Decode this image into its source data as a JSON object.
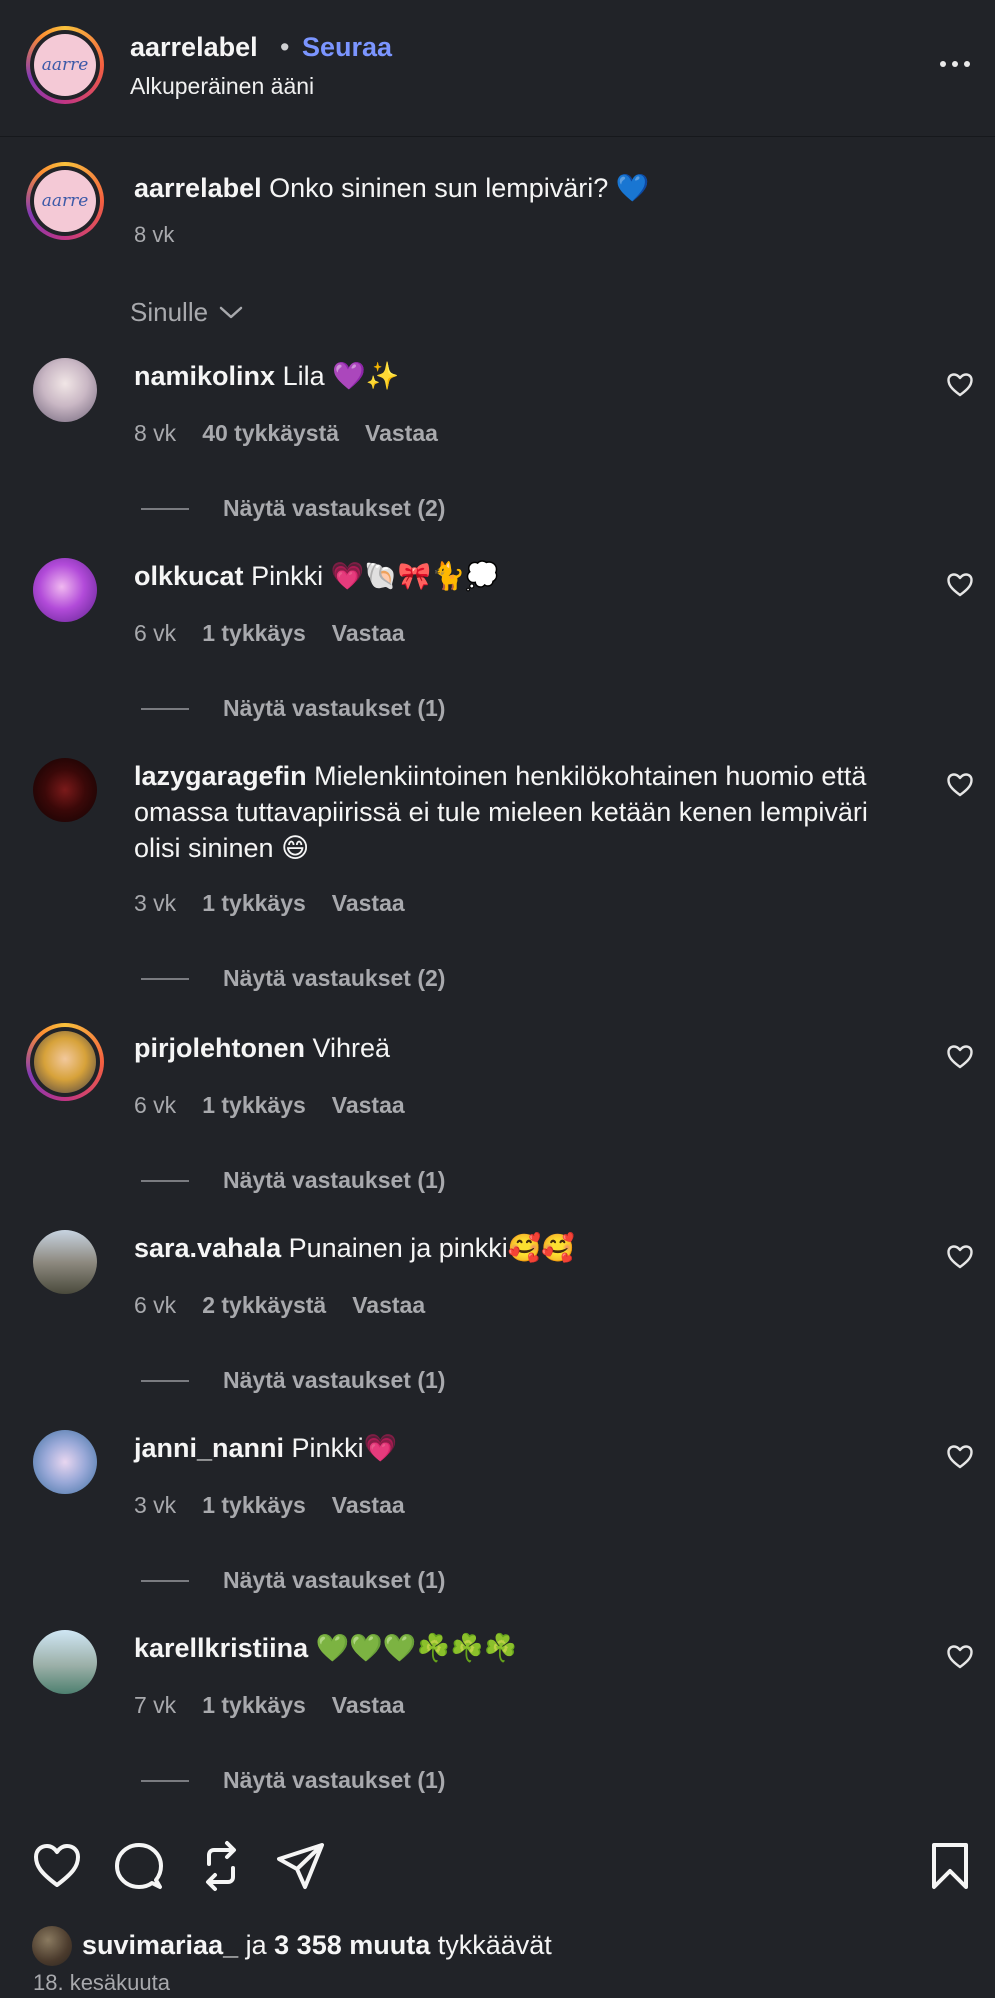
{
  "header": {
    "username": "aarrelabel",
    "separator": "•",
    "follow_label": "Seuraa",
    "subtitle": "Alkuperäinen ääni",
    "avatar_text": "aarre",
    "more_icon": "more-horizontal-icon"
  },
  "caption": {
    "username": "aarrelabel",
    "text": "Onko sininen sun lempiväri? 💙",
    "time": "8 vk"
  },
  "sort": {
    "label": "Sinulle"
  },
  "comments": [
    {
      "username": "namikolinx",
      "text": "Lila 💜✨",
      "time": "8 vk",
      "likes": "40 tykkäystä",
      "reply": "Vastaa",
      "view_replies": "Näytä vastaukset (2)"
    },
    {
      "username": "olkkucat",
      "text": "Pinkki 💗🐚🎀🐈💭",
      "time": "6 vk",
      "likes": "1 tykkäys",
      "reply": "Vastaa",
      "view_replies": "Näytä vastaukset (1)"
    },
    {
      "username": "lazygaragefin",
      "text": "Mielenkiintoinen henkilökohtainen huomio että omassa tuttavapiirissä ei tule mieleen ketään kenen lempiväri olisi sininen 😄",
      "time": "3 vk",
      "likes": "1 tykkäys",
      "reply": "Vastaa",
      "view_replies": "Näytä vastaukset (2)"
    },
    {
      "username": "pirjolehtonen",
      "text": "Vihreä",
      "time": "6 vk",
      "likes": "1 tykkäys",
      "reply": "Vastaa",
      "view_replies": "Näytä vastaukset (1)"
    },
    {
      "username": "sara.vahala",
      "text": "Punainen ja pinkki🥰🥰",
      "time": "6 vk",
      "likes": "2 tykkäystä",
      "reply": "Vastaa",
      "view_replies": "Näytä vastaukset (1)"
    },
    {
      "username": "janni_nanni",
      "text": "Pinkki💗",
      "time": "3 vk",
      "likes": "1 tykkäys",
      "reply": "Vastaa",
      "view_replies": "Näytä vastaukset (1)"
    },
    {
      "username": "karellkristiina",
      "text": "💚💚💚☘️☘️☘️",
      "time": "7 vk",
      "likes": "1 tykkäys",
      "reply": "Vastaa",
      "view_replies": "Näytä vastaukset (1)"
    }
  ],
  "actions": {
    "like_icon": "heart-icon",
    "comment_icon": "comment-icon",
    "repost_icon": "repost-icon",
    "share_icon": "send-icon",
    "save_icon": "bookmark-icon"
  },
  "likes_summary": {
    "user": "suvimariaa_",
    "joiner": "ja",
    "count": "3 358 muuta",
    "suffix": "tykkäävät"
  },
  "date": "18. kesäkuuta",
  "colors": {
    "background": "#212328",
    "follow": "#7b95ff",
    "muted": "#a8a9ad"
  }
}
